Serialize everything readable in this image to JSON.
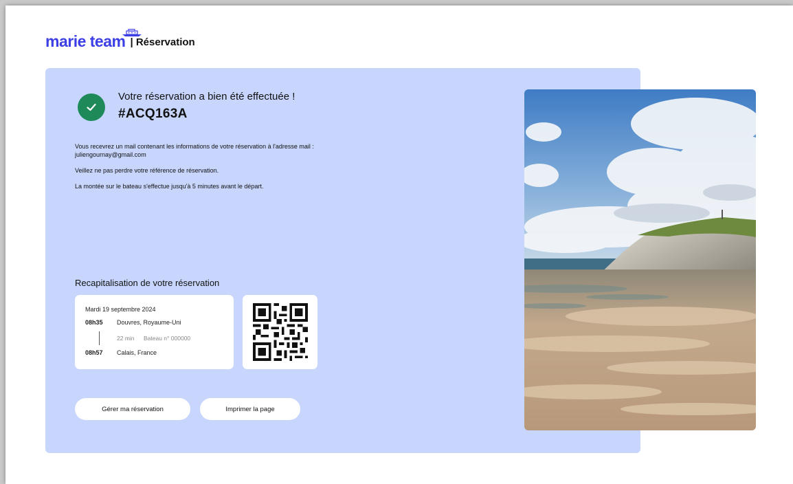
{
  "brand": {
    "logo_text": "marie team",
    "section_label": "| Réservation"
  },
  "confirmation": {
    "title": "Votre réservation a bien été effectuée !",
    "reference": "#ACQ163A"
  },
  "info": {
    "line1": "Vous recevrez un mail contenant les informations de votre réservation à l'adresse mail :",
    "email": "juliengournay@gmail.com",
    "line2": "Veillez ne pas perdre votre référence de réservation.",
    "line3": "La montée sur le bateau s'effectue jusqu'à 5 minutes avant le départ."
  },
  "recap": {
    "title": "Recapitalisation de votre réservation",
    "date": "Mardi 19 septembre 2024",
    "departure_time": "08h35",
    "departure_place": "Douvres, Royaume-Uni",
    "duration": "22 min",
    "boat": "Bateau n° 000000",
    "arrival_time": "08h57",
    "arrival_place": "Calais, France"
  },
  "actions": {
    "manage": "Gérer ma réservation",
    "print": "Imprimer la page"
  },
  "colors": {
    "brand": "#3c3ee6",
    "panel": "#c8d6fd",
    "success": "#1e8a5a"
  },
  "icons": {
    "check": "check-circle-icon",
    "boat": "boat-icon",
    "qr": "qr-code"
  }
}
